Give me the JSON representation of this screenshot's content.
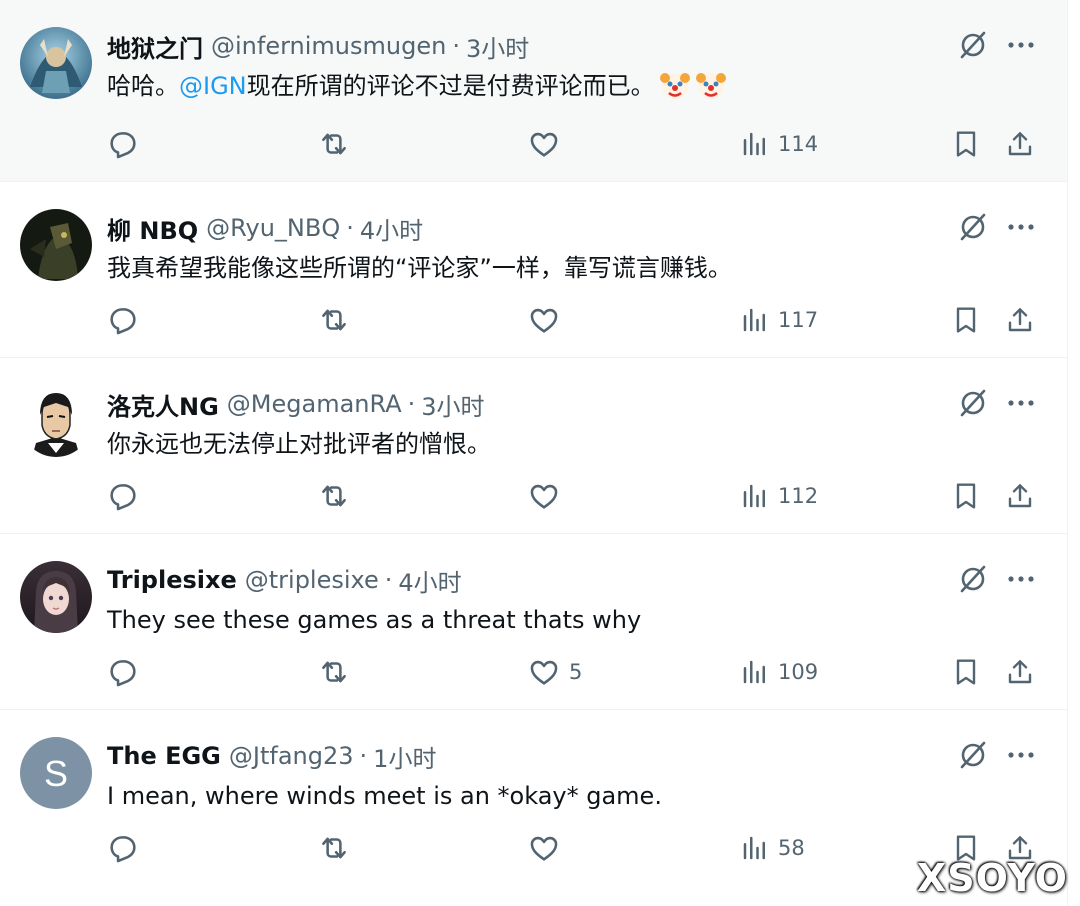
{
  "tweets": [
    {
      "display_name": "地狱之门",
      "handle": "@infernimusmugen",
      "time": "3小时",
      "text_parts": [
        "哈哈。",
        "@IGN",
        "现在所谓的评论不过是付费评论而已。"
      ],
      "emoji": [
        "clown-face-emoji",
        "clown-face-emoji"
      ],
      "likes": "",
      "views": "114",
      "avatar_kind": "fantasy-art"
    },
    {
      "display_name": "柳 NBQ",
      "handle": "@Ryu_NBQ",
      "time": "4小时",
      "text": "我真希望我能像这些所谓的“评论家”一样，靠写谎言赚钱。",
      "likes": "",
      "views": "117",
      "avatar_kind": "dark-knight"
    },
    {
      "display_name": "洛克人NG",
      "handle": "@MegamanRA",
      "time": "3小时",
      "text": "你永远也无法停止对批评者的憎恨。",
      "likes": "",
      "views": "112",
      "avatar_kind": "anime-man"
    },
    {
      "display_name": "Triplesixe",
      "handle": "@triplesixe",
      "time": "4小时",
      "text": "They see these games as a threat thats why",
      "likes": "5",
      "views": "109",
      "avatar_kind": "anime-girl"
    },
    {
      "display_name": "The EGG",
      "handle": "@Jtfang23",
      "time": "1小时",
      "text": "I mean, where winds meet is an *okay* game.",
      "likes": "",
      "views": "58",
      "avatar_kind": "letter",
      "avatar_letter": "S"
    }
  ],
  "separator": "·",
  "watermark": "XSOYO",
  "colors": {
    "text": "#0f1419",
    "secondary": "#536471",
    "link": "#1d9bf0",
    "hover_bg": "#f7f9f9",
    "divider": "#eff3f4",
    "letter_avatar_bg": "#7d93a5"
  },
  "icons": [
    "reply-icon",
    "retweet-icon",
    "like-icon",
    "views-icon",
    "bookmark-icon",
    "share-icon",
    "grok-icon",
    "more-icon"
  ]
}
